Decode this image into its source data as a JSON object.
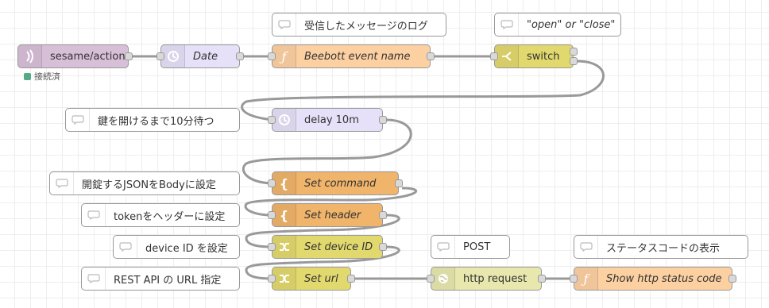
{
  "colors": {
    "mqtt": "#d8bfd8",
    "delay": "#e6e0f8",
    "function": "#fdd0a2",
    "switch": "#e2d96e",
    "template": "#f0b46b",
    "change": "#e2d96e",
    "http": "#e7e7ae",
    "comment": "#ffffff",
    "wire": "#999999",
    "status_connected": "#55aa88"
  },
  "nodes": {
    "mqtt_in": {
      "label": "sesame/action",
      "icon": "bridge-icon",
      "status": "接続済"
    },
    "date": {
      "label": "Date",
      "icon": "timer-icon"
    },
    "beebott": {
      "label": "Beebott event name",
      "icon": "function-icon"
    },
    "switch": {
      "label": "switch",
      "icon": "switch-icon"
    },
    "delay": {
      "label": "delay 10m",
      "icon": "timer-icon"
    },
    "set_command": {
      "label": "Set command",
      "icon": "template-icon"
    },
    "set_header": {
      "label": "Set header",
      "icon": "template-icon"
    },
    "set_device": {
      "label": "Set device ID",
      "icon": "shuffle-icon"
    },
    "set_url": {
      "label": "Set url",
      "icon": "shuffle-icon"
    },
    "http_request": {
      "label": "http request",
      "icon": "globe-icon"
    },
    "show_status": {
      "label": "Show http status code",
      "icon": "function-icon"
    }
  },
  "comments": {
    "log": "受信したメッセージのログ",
    "open_close": "\"open\" or \"close\"",
    "wait": "鍵を開けるまで10分待つ",
    "json_body": "開錠するJSONをBodyに設定",
    "token": "tokenをヘッダーに設定",
    "device": "device ID を設定",
    "rest": "REST API の URL 指定",
    "post": "POST",
    "status_display": "ステータスコードの表示"
  }
}
